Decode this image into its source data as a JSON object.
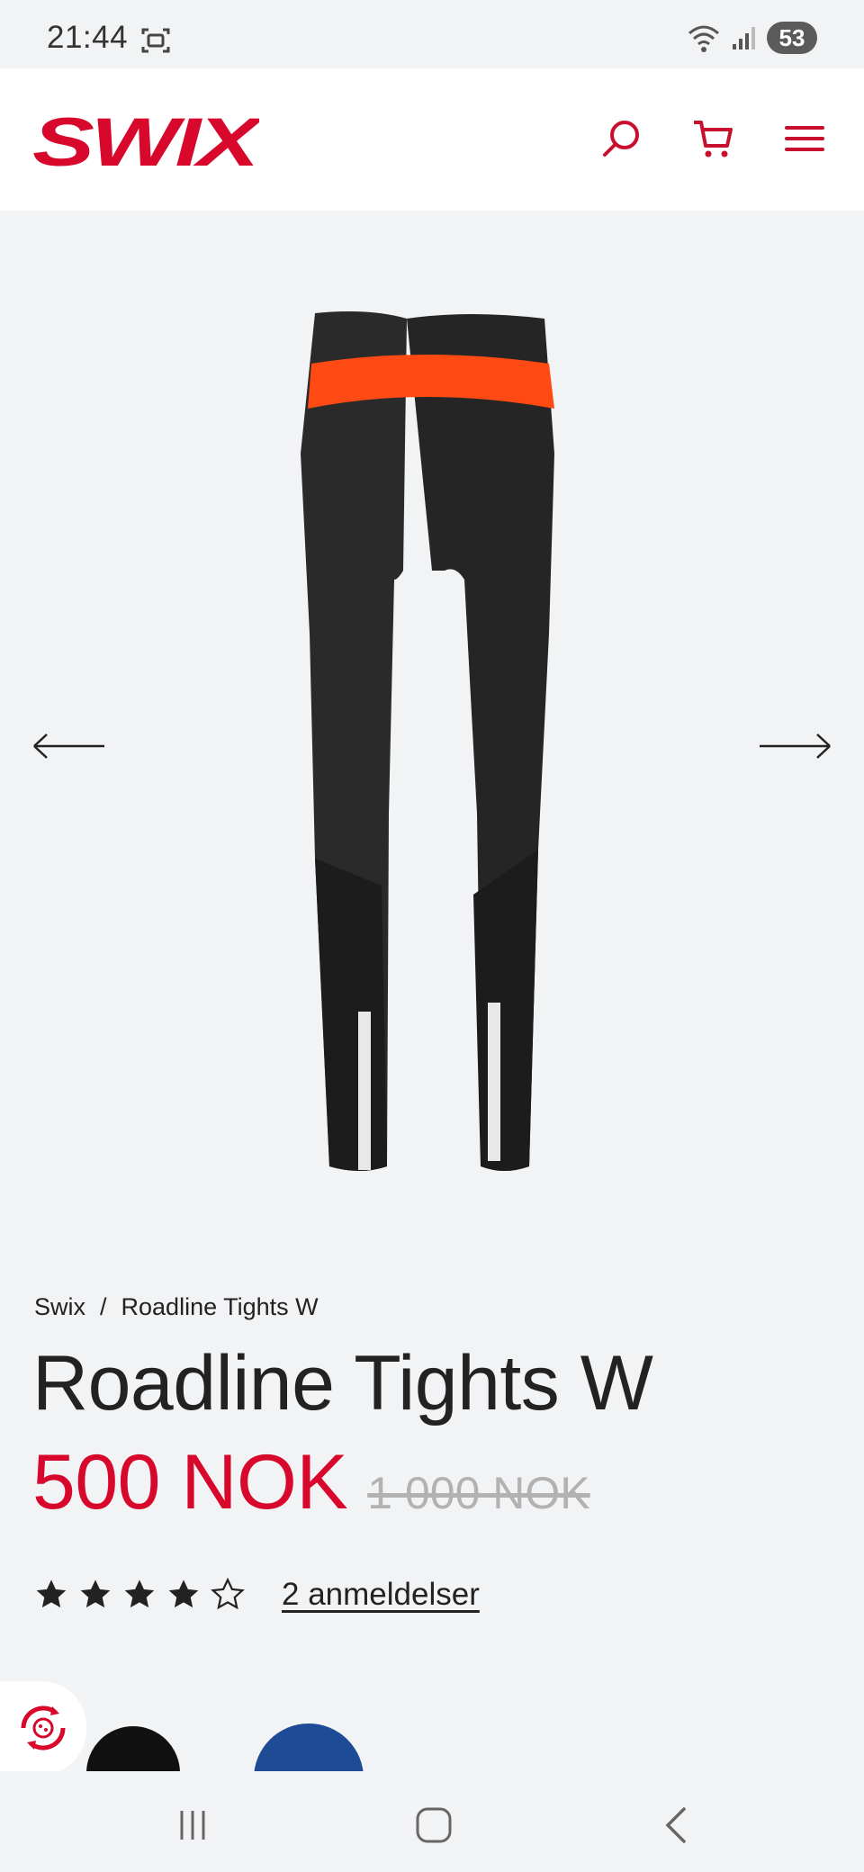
{
  "status": {
    "time": "21:44",
    "battery": "53"
  },
  "brand": {
    "name": "SWIX",
    "color": "#d7082b"
  },
  "header": {
    "icons": [
      "search-icon",
      "cart-icon",
      "menu-icon"
    ]
  },
  "gallery": {
    "prev_icon": "arrow-left-icon",
    "next_icon": "arrow-right-icon"
  },
  "breadcrumb": {
    "items": [
      "Swix",
      "Roadline Tights W"
    ],
    "separator": "/"
  },
  "product": {
    "title": "Roadline Tights W",
    "price": "500 NOK",
    "original_price": "1 000 NOK",
    "rating": 4,
    "rating_max": 5,
    "reviews_label": "2 anmeldelser"
  },
  "swatches": {
    "colors": [
      "#111111",
      "#1e4b96"
    ]
  },
  "navbar": {
    "icons": [
      "recent-apps-icon",
      "home-icon",
      "back-icon"
    ]
  }
}
